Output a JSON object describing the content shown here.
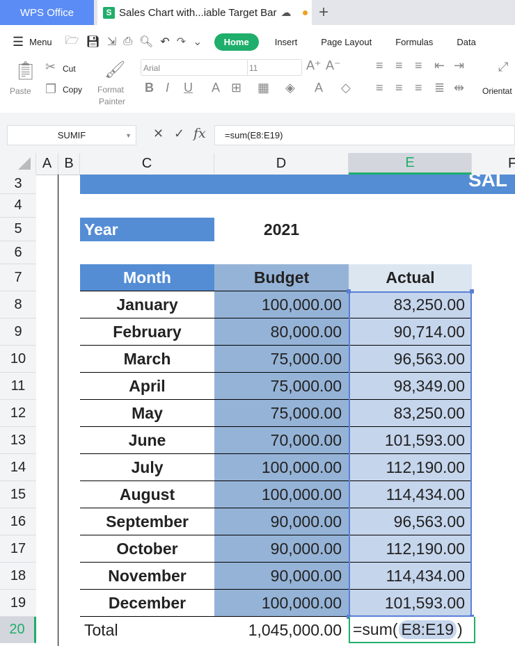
{
  "tabs": {
    "app": "WPS Office",
    "document": "Sales Chart with...iable Target Bar",
    "new_tab": "+"
  },
  "menu": {
    "menu_label": "Menu",
    "tabs": [
      "Home",
      "Insert",
      "Page Layout",
      "Formulas",
      "Data"
    ]
  },
  "ribbon": {
    "paste": "Paste",
    "cut": "Cut",
    "copy": "Copy",
    "format_painter_1": "Format",
    "format_painter_2": "Painter",
    "font": "Arial",
    "size": "11",
    "orientation": "Orientat"
  },
  "formula_bar": {
    "name_box": "SUMIF",
    "fx": "fx",
    "formula": "=sum(E8:E19)"
  },
  "columns": [
    "A",
    "B",
    "C",
    "D",
    "E",
    "F"
  ],
  "selected_column": "E",
  "rows": [
    "3",
    "4",
    "5",
    "6",
    "7",
    "8",
    "9",
    "10",
    "11",
    "12",
    "13",
    "14",
    "15",
    "16",
    "17",
    "18",
    "19",
    "20"
  ],
  "sheet": {
    "title_fragment": "SAL",
    "year_label": "Year",
    "year_value": "2021",
    "headers": [
      "Month",
      "Budget",
      "Actual"
    ],
    "data": [
      [
        "January",
        "100,000.00",
        "83,250.00"
      ],
      [
        "February",
        "80,000.00",
        "90,714.00"
      ],
      [
        "March",
        "75,000.00",
        "96,563.00"
      ],
      [
        "April",
        "75,000.00",
        "98,349.00"
      ],
      [
        "May",
        "75,000.00",
        "83,250.00"
      ],
      [
        "June",
        "70,000.00",
        "101,593.00"
      ],
      [
        "July",
        "100,000.00",
        "112,190.00"
      ],
      [
        "August",
        "100,000.00",
        "114,434.00"
      ],
      [
        "September",
        "90,000.00",
        "96,563.00"
      ],
      [
        "October",
        "90,000.00",
        "112,190.00"
      ],
      [
        "November",
        "90,000.00",
        "114,434.00"
      ],
      [
        "December",
        "100,000.00",
        "101,593.00"
      ]
    ],
    "total_label": "Total",
    "total_budget": "1,045,000.00",
    "editing": {
      "prefix": "=sum(",
      "range": "E8:E19",
      "suffix": ")"
    }
  },
  "colors": {
    "accent": "#1fae6b",
    "header_blue": "#548dd4",
    "budget": "#95b3d7",
    "actual": "#c5d5ec",
    "actual_header": "#dce6f1"
  }
}
